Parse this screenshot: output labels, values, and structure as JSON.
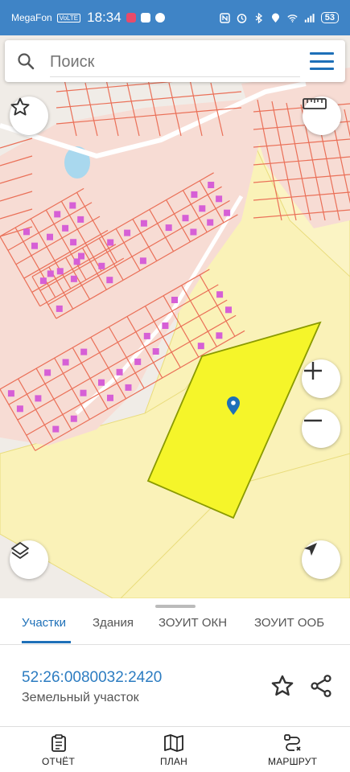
{
  "status_bar": {
    "carrier": "MegaFon",
    "network_badge": "VoLTE",
    "time": "18:34",
    "battery": "53"
  },
  "search": {
    "placeholder": "Поиск"
  },
  "map": {
    "parcel_fill_color": "#f5f52a",
    "parcel_stroke_color": "#8a9a00",
    "cadastral_line_color": "#ea7058",
    "building_color": "#d65fd6",
    "marker_color": "#1e70b8"
  },
  "tabs": [
    {
      "label": "Участки",
      "active": true
    },
    {
      "label": "Здания",
      "active": false
    },
    {
      "label": "ЗОУИТ ОКН",
      "active": false
    },
    {
      "label": "ЗОУИТ ООБ",
      "active": false
    }
  ],
  "parcel": {
    "cadastral_number": "52:26:0080032:2420",
    "type": "Земельный участок"
  },
  "bottom_nav": [
    {
      "label": "ОТЧЁТ",
      "icon": "report-icon"
    },
    {
      "label": "ПЛАН",
      "icon": "map-icon"
    },
    {
      "label": "МАРШРУТ",
      "icon": "route-icon"
    }
  ]
}
